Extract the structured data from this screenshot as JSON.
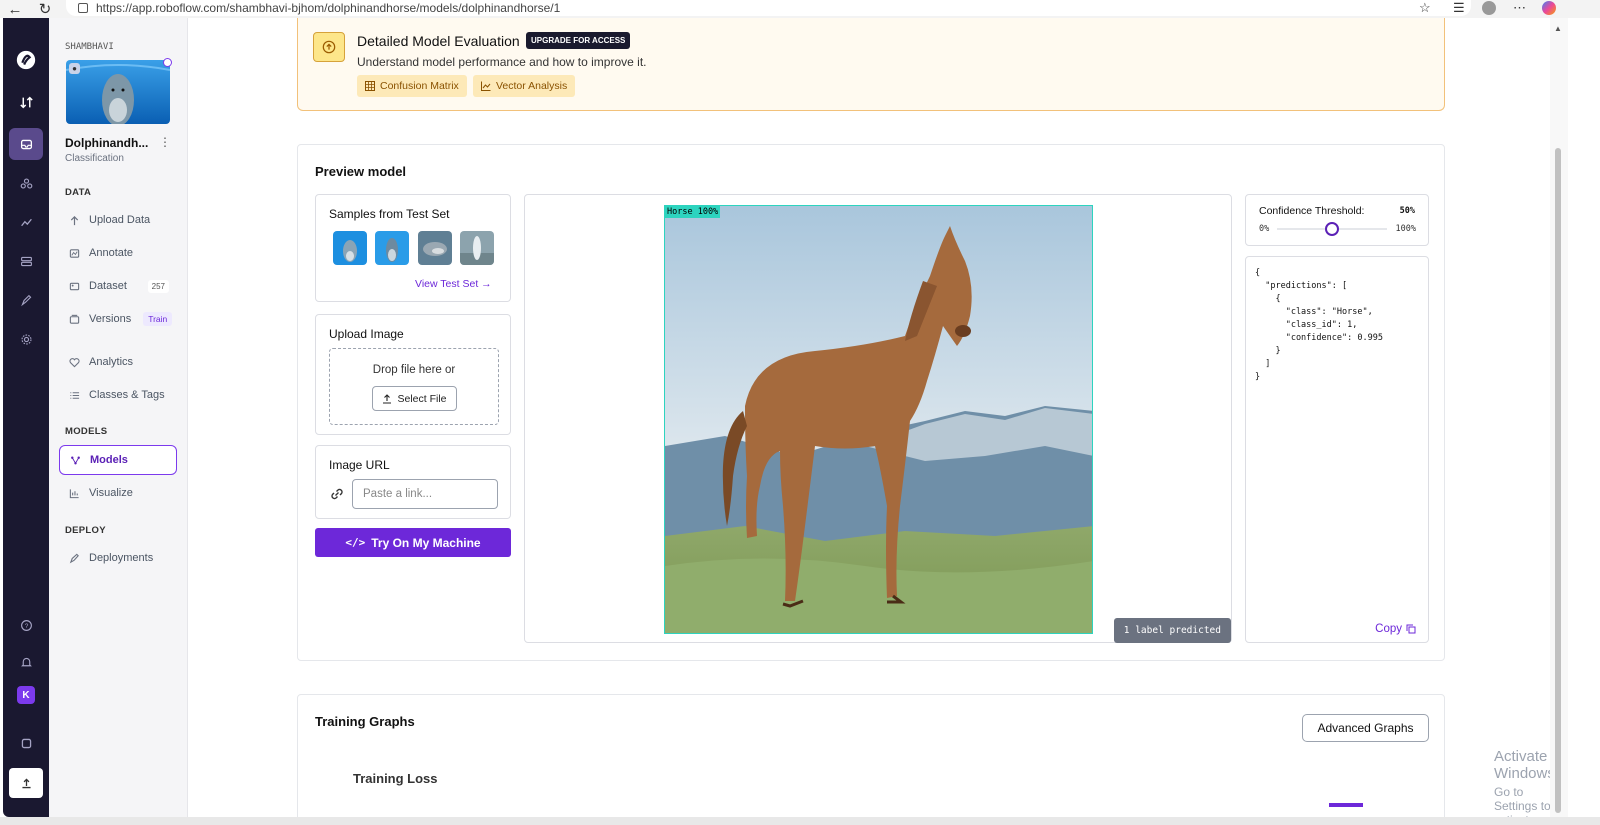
{
  "browser": {
    "url": "https://app.roboflow.com/shambhavi-bjhom/dolphinandhorse/models/dolphinandhorse/1"
  },
  "sidebar": {
    "workspace": "SHAMBHAVI",
    "project_name": "Dolphinandh...",
    "project_type": "Classification",
    "sections": {
      "data": "DATA",
      "models": "MODELS",
      "deploy": "DEPLOY"
    },
    "items": {
      "upload": "Upload Data",
      "annotate": "Annotate",
      "dataset": "Dataset",
      "dataset_count": "257",
      "versions": "Versions",
      "versions_badge": "Train",
      "analytics": "Analytics",
      "classes": "Classes & Tags",
      "models": "Models",
      "visualize": "Visualize",
      "deployments": "Deployments"
    },
    "user_initial": "K"
  },
  "eval_banner": {
    "title": "Detailed Model Evaluation",
    "upgrade": "UPGRADE FOR ACCESS",
    "subtitle": "Understand model performance and how to improve it.",
    "chip_confusion": "Confusion Matrix",
    "chip_vector": "Vector Analysis"
  },
  "preview": {
    "title": "Preview model",
    "samples_title": "Samples from Test Set",
    "view_test_set": "View Test Set →",
    "upload_title": "Upload Image",
    "drop_text": "Drop file here or",
    "select_file": "Select File",
    "url_title": "Image URL",
    "url_placeholder": "Paste a link...",
    "try_button": "Try On My Machine",
    "prediction_tag": "Horse 100%",
    "labels_predicted": "1 label predicted",
    "confidence_title": "Confidence Threshold:",
    "confidence_value": "50%",
    "confidence_level": 0.5,
    "confidence_min": "0%",
    "confidence_max": "100%",
    "json_output": "{\n  \"predictions\": [\n    {\n      \"class\": \"Horse\",\n      \"class_id\": 1,\n      \"confidence\": 0.995\n    }\n  ]\n}",
    "copy": "Copy"
  },
  "training": {
    "title": "Training Graphs",
    "advanced_button": "Advanced Graphs",
    "loss_title": "Training Loss"
  },
  "watermark": {
    "line1": "Activate Windows",
    "line2": "Go to Settings to activate Windows."
  },
  "colors": {
    "accent": "#6d28d9",
    "rail": "#1a1830",
    "banner_bg": "#fffaf0",
    "prediction_box": "#2dd4bf"
  }
}
